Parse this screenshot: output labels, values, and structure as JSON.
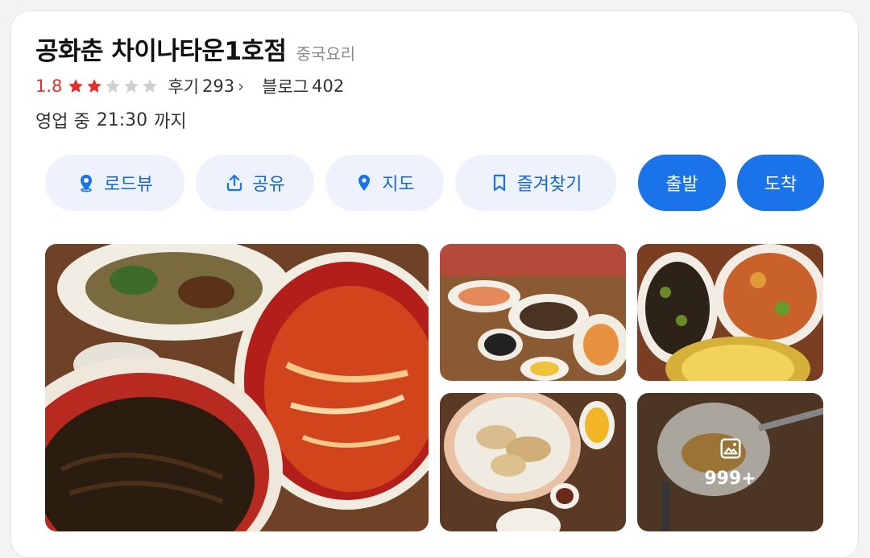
{
  "place": {
    "name": "공화춘 차이나타운1호점",
    "category": "중국요리",
    "rating": "1.8",
    "rating_value": 1.8,
    "rating_max": 5,
    "review_label": "후기",
    "review_count": "293",
    "blog_label": "블로그",
    "blog_count": "402",
    "status": "영업 중",
    "close_time": "21:30",
    "until": "까지"
  },
  "actions": {
    "roadview": "로드뷰",
    "share": "공유",
    "map": "지도",
    "favorite": "즐겨찾기",
    "depart": "출발",
    "arrive": "도착"
  },
  "photos": {
    "more_count": "999+"
  },
  "colors": {
    "accent": "#1a73e8",
    "soft_button": "#edf2fd",
    "rating_red": "#e1312c",
    "star_filled": "#e1312c",
    "star_empty": "#d0d0d0"
  }
}
